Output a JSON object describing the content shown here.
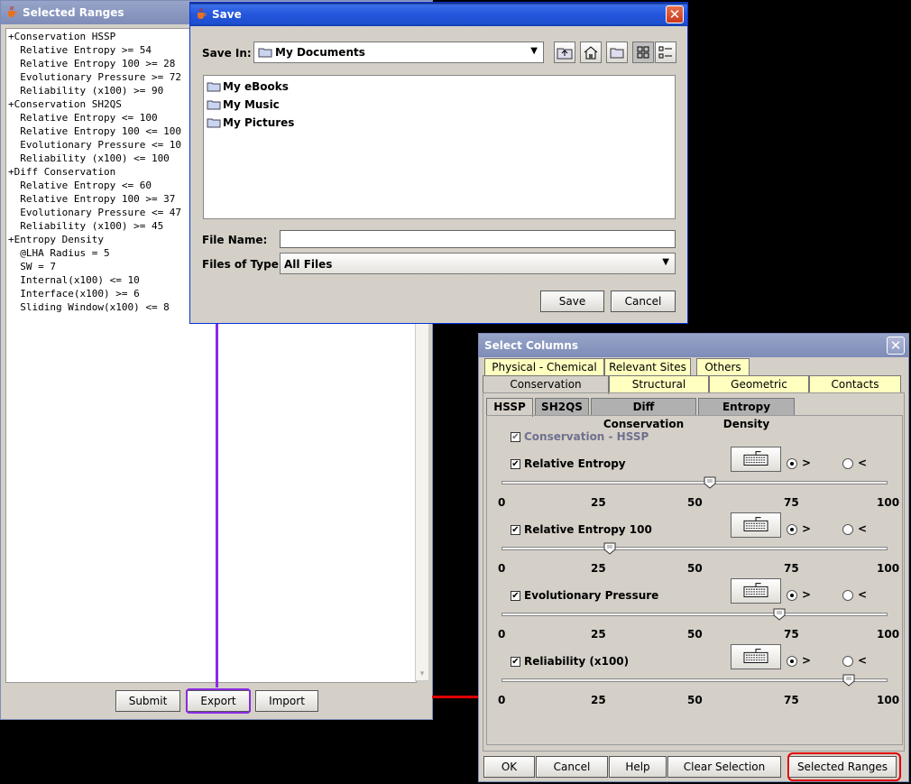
{
  "selected_ranges": {
    "title": "Selected Ranges",
    "lines": [
      "+Conservation HSSP",
      "  Relative Entropy >= 54",
      "  Relative Entropy 100 >= 28",
      "  Evolutionary Pressure >= 72",
      "  Reliability (x100) >= 90",
      "+Conservation SH2QS",
      "  Relative Entropy <= 100",
      "  Relative Entropy 100 <= 100",
      "  Evolutionary Pressure <= 10",
      "  Reliability (x100) <= 100",
      "+Diff Conservation",
      "  Relative Entropy <= 60",
      "  Relative Entropy 100 >= 37",
      "  Evolutionary Pressure <= 47",
      "  Reliability (x100) >= 45",
      "+Entropy Density",
      "  @LHA Radius = 5",
      "  SW = 7",
      "  Internal(x100) <= 10",
      "  Interface(x100) >= 6",
      "  Sliding Window(x100) <= 8"
    ],
    "buttons": {
      "submit": "Submit",
      "export": "Export",
      "import": "Import"
    }
  },
  "save": {
    "title": "Save",
    "save_in_label": "Save In:",
    "save_in_value": "My Documents",
    "files": [
      "My eBooks",
      "My Music",
      "My Pictures"
    ],
    "file_name_label": "File Name:",
    "file_name_value": "",
    "files_of_type_label": "Files of Type:",
    "files_of_type_value": "All Files",
    "save_button": "Save",
    "cancel_button": "Cancel"
  },
  "select_columns": {
    "title": "Select Columns",
    "tabs_row1": [
      "Physical - Chemical",
      "Relevant Sites",
      "Others"
    ],
    "tabs_row2": [
      "Conservation",
      "Structural",
      "Geometric",
      "Contacts"
    ],
    "subtabs": [
      "HSSP",
      "SH2QS",
      "Diff Conservation",
      "Entropy Density"
    ],
    "group_label": "Conservation - HSSP",
    "gt_label": ">",
    "lt_label": "<",
    "ticks": [
      "0",
      "25",
      "50",
      "75",
      "100"
    ],
    "sliders": [
      {
        "label": "Relative Entropy",
        "value": 54,
        "op": ">"
      },
      {
        "label": "Relative Entropy 100",
        "value": 28,
        "op": ">"
      },
      {
        "label": "Evolutionary Pressure",
        "value": 72,
        "op": ">"
      },
      {
        "label": "Reliability (x100)",
        "value": 90,
        "op": ">"
      }
    ],
    "buttons": {
      "ok": "OK",
      "cancel": "Cancel",
      "help": "Help",
      "clear": "Clear Selection",
      "ranges": "Selected Ranges"
    }
  },
  "annotation_colors": {
    "export_link": "#8a2be2",
    "ranges_link": "#e00000"
  }
}
